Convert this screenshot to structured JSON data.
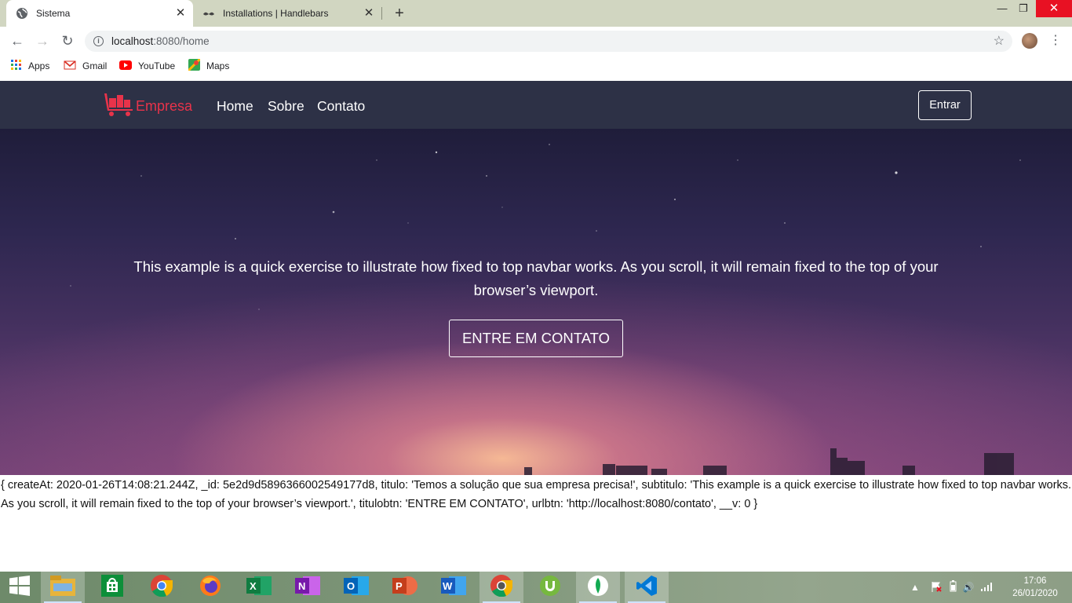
{
  "browser": {
    "tabs": [
      {
        "title": "Sistema",
        "active": true,
        "icon": "globe-icon"
      },
      {
        "title": "Installations | Handlebars",
        "active": false,
        "icon": "handlebars-mustache-icon"
      }
    ],
    "url_host": "localhost",
    "url_rest": ":8080/home",
    "bookmarks": [
      {
        "label": "Apps",
        "icon": "apps-grid-icon"
      },
      {
        "label": "Gmail",
        "icon": "gmail-icon"
      },
      {
        "label": "YouTube",
        "icon": "youtube-icon"
      },
      {
        "label": "Maps",
        "icon": "maps-icon"
      }
    ]
  },
  "site": {
    "brand": "Empresa",
    "nav": [
      "Home",
      "Sobre",
      "Contato"
    ],
    "login_button": "Entrar",
    "hero_subtitle": "This example is a quick exercise to illustrate how fixed to top navbar works. As you scroll, it will remain fixed to the top of your browser’s viewport.",
    "hero_button": "ENTRE EM CONTATO"
  },
  "debug_output": "{ createAt: 2020-01-26T14:08:21.244Z, _id: 5e2d9d5896366002549177d8, titulo: 'Temos a solução que sua empresa precisa!', subtitulo: 'This example is a quick exercise to illustrate how fixed to top navbar works. As you scroll, it will remain fixed to the top of your browser’s viewport.', titulobtn: 'ENTRE EM CONTATO', urlbtn: 'http://localhost:8080/contato', __v: 0 }",
  "taskbar": {
    "apps": [
      "File Explorer",
      "Microsoft Store",
      "Google Chrome",
      "Firefox",
      "Excel",
      "OneNote",
      "Outlook",
      "PowerPoint",
      "Word",
      "Chrome Dev",
      "uTorrent",
      "MongoDB Compass",
      "Visual Studio Code"
    ],
    "time": "17:06",
    "date": "26/01/2020"
  }
}
